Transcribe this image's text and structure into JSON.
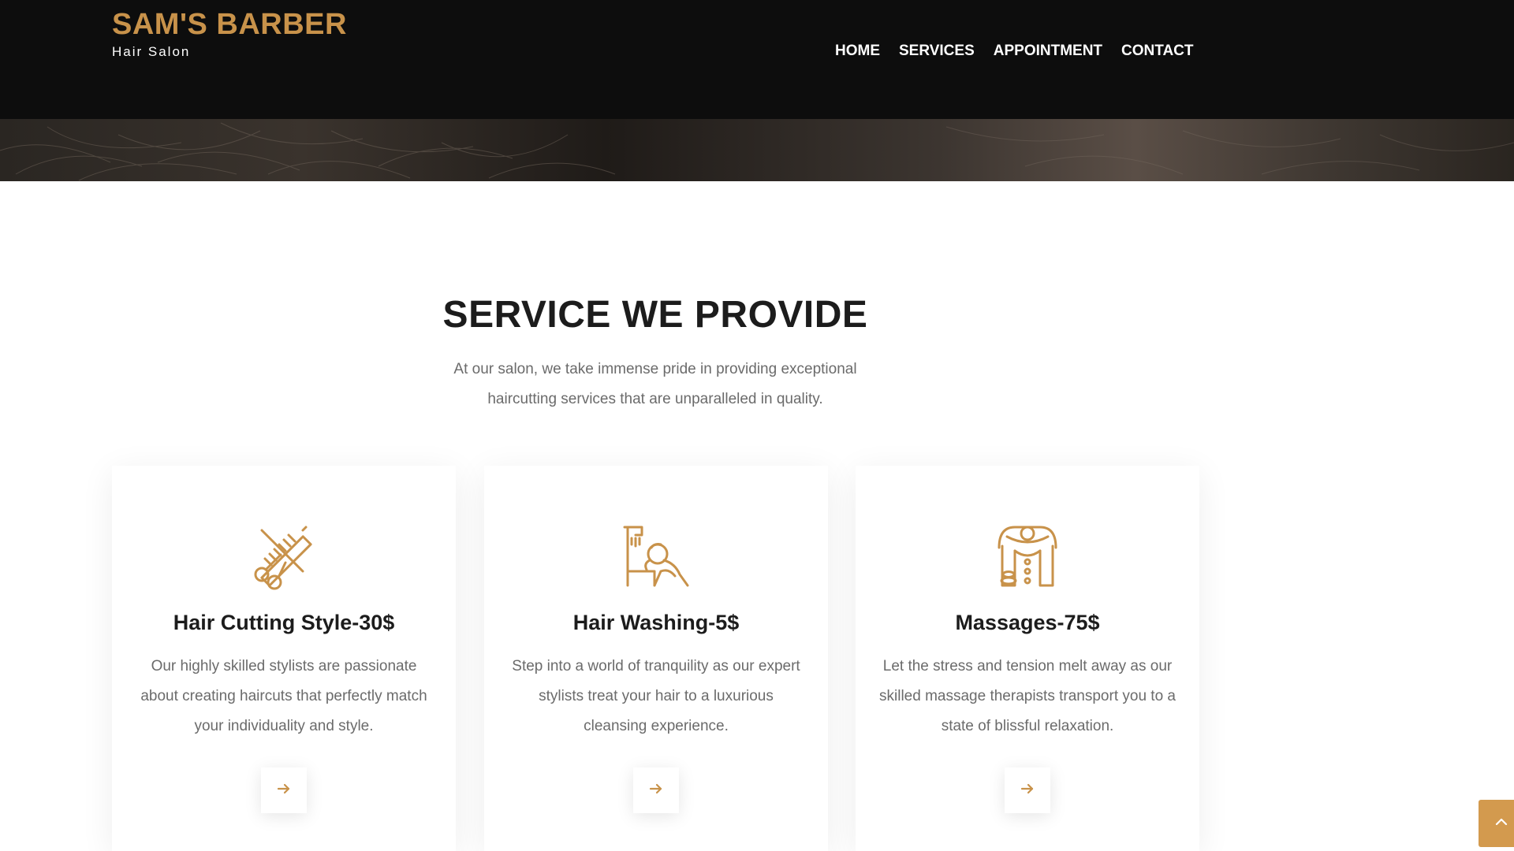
{
  "header": {
    "brand_title": "SAM'S BARBER",
    "brand_subtitle": "Hair Salon",
    "nav": [
      "HOME",
      "SERVICES",
      "APPOINTMENT",
      "CONTACT"
    ]
  },
  "services": {
    "title": "SERVICE WE PROVIDE",
    "description": "At our salon, we take immense pride in providing exceptional haircutting services that are unparalleled in quality.",
    "cards": [
      {
        "icon": "scissors-comb-icon",
        "title": "Hair Cutting Style-30$",
        "text": "Our highly skilled stylists are passionate about creating haircuts that perfectly match your individuality and style."
      },
      {
        "icon": "hair-washing-icon",
        "title": "Hair Washing-5$",
        "text": "Step into a world of tranquility as our expert stylists treat your hair to a luxurious cleansing experience."
      },
      {
        "icon": "massage-icon",
        "title": "Massages-75$",
        "text": "Let the stress and tension melt away as our skilled massage therapists transport you to a state of blissful relaxation."
      }
    ]
  },
  "colors": {
    "accent": "#c8924a",
    "header_bg": "#0d0d0d",
    "scroll_top_bg": "#d39a4e"
  }
}
